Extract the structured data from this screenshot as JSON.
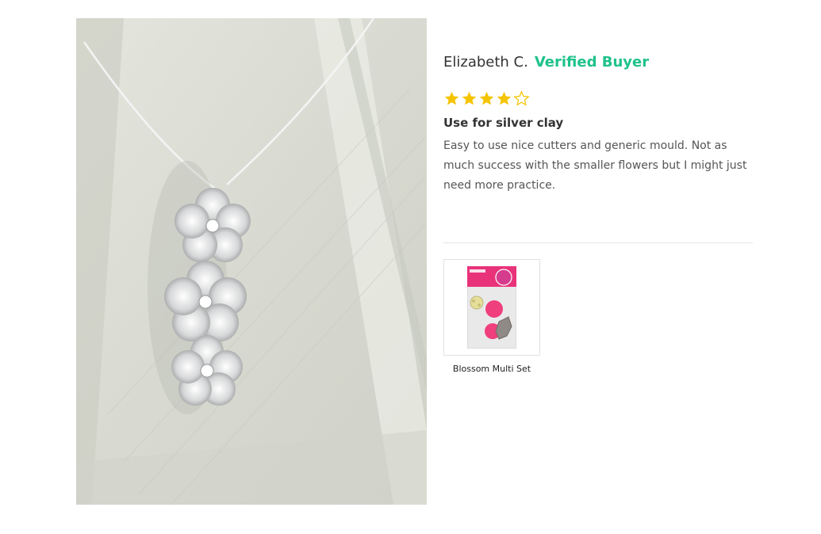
{
  "review": {
    "reviewer_name": "Elizabeth C.",
    "verified_label": "Verified Buyer",
    "rating": 4,
    "rating_max": 5,
    "title": "Use for silver clay",
    "body": "Easy to use nice cutters and generic mould. Not as much success with the smaller flowers but I might just need more practice."
  },
  "photo": {
    "description_icon": "silver-flower-pendant-photo"
  },
  "product": {
    "label": "Blossom Multi Set",
    "thumb_icon": "product-package-thumbnail"
  },
  "colors": {
    "verified": "#1ec28b",
    "star": "#f5c400",
    "text": "#333333",
    "body_text": "#555555"
  }
}
